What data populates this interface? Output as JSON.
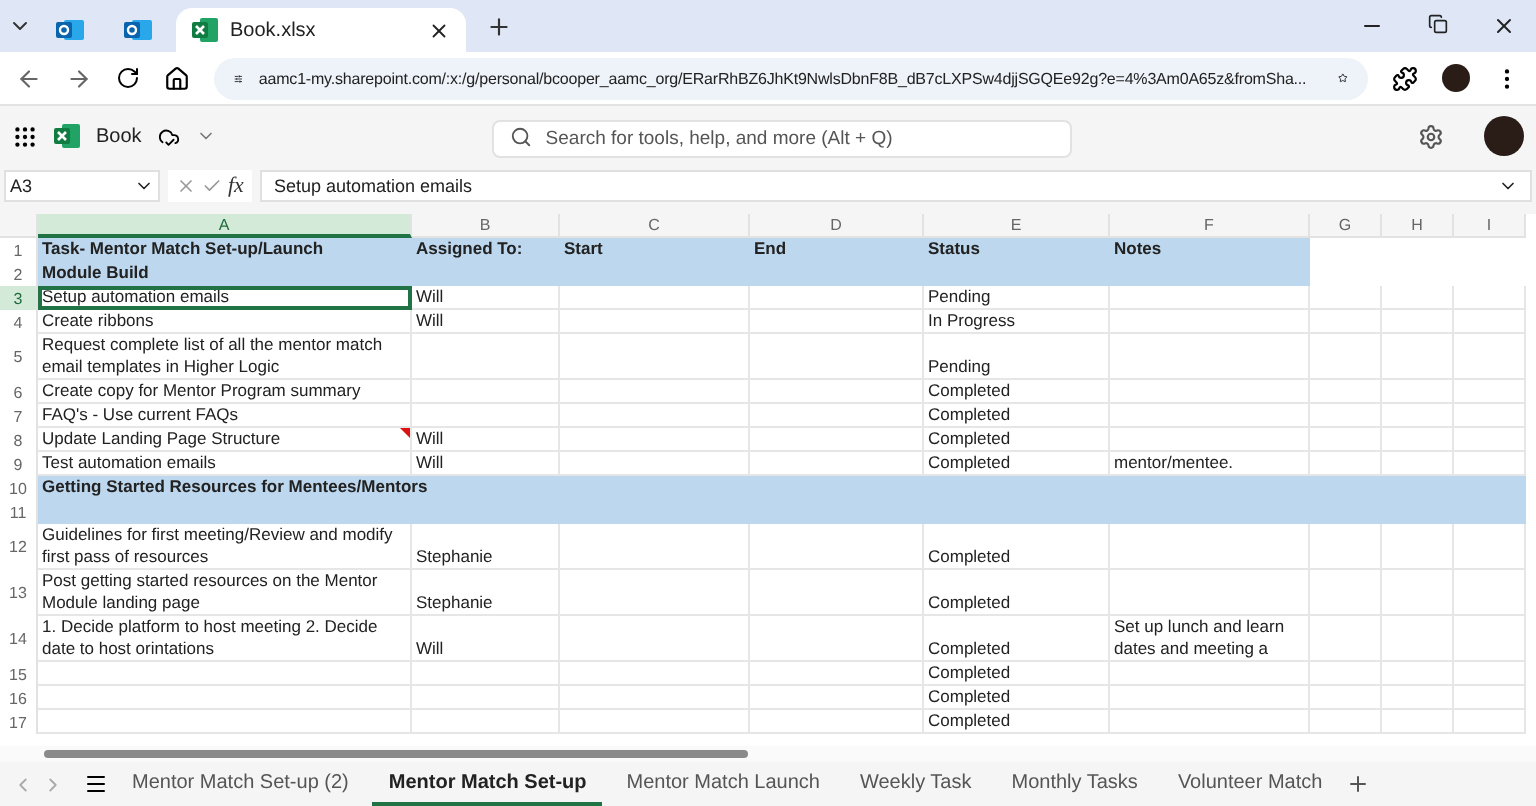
{
  "browser": {
    "tabs": [
      {
        "kind": "icon",
        "selected": false
      },
      {
        "kind": "icon",
        "selected": false
      },
      {
        "kind": "document",
        "title": "Book.xlsx",
        "selected": true
      }
    ],
    "url": "aamc1-my.sharepoint.com/:x:/g/personal/bcooper_aamc_org/ERarRhBZ6JhKt9NwlsDbnF8B_dB7cLXPSw4djjSGQEe92g?e=4%3Am0A65z&fromSha..."
  },
  "app": {
    "document": "Book",
    "search": {
      "placeholder": "Search for tools, help, and more (Alt + Q)"
    }
  },
  "formula_bar": {
    "name_box": "A3",
    "function_label": "fx",
    "formula": "Setup automation emails"
  },
  "columns": [
    {
      "label": "A",
      "selected": true
    },
    {
      "label": "B",
      "selected": false
    },
    {
      "label": "C",
      "selected": false
    },
    {
      "label": "D",
      "selected": false
    },
    {
      "label": "E",
      "selected": false
    },
    {
      "label": "F",
      "selected": false
    },
    {
      "label": "G",
      "selected": false
    },
    {
      "label": "H",
      "selected": false
    },
    {
      "label": "I",
      "selected": false
    }
  ],
  "rows": [
    {
      "number": "1",
      "kind": "title",
      "selected": false,
      "comment": false,
      "cells": {
        "task": "Task- Mentor Match Set-up/Launch",
        "assigned": "Assigned To:",
        "start": "Start",
        "end": "End",
        "status": "Status",
        "notes": "Notes"
      }
    },
    {
      "number": "2",
      "kind": "title",
      "selected": false,
      "comment": false,
      "cells": {
        "task": "Module Build"
      }
    },
    {
      "number": "3",
      "kind": "task",
      "selected": true,
      "comment": false,
      "cells": {
        "task": "Setup automation emails",
        "assigned": "Will",
        "status": "Pending"
      }
    },
    {
      "number": "4",
      "kind": "task",
      "selected": false,
      "comment": false,
      "cells": {
        "task": "Create ribbons",
        "assigned": "Will",
        "status": "In Progress"
      }
    },
    {
      "number": "5",
      "kind": "task",
      "selected": false,
      "comment": false,
      "cells": {
        "task": "Request complete list of all the mentor match email templates in Higher Logic",
        "status": "Pending"
      }
    },
    {
      "number": "6",
      "kind": "task",
      "selected": false,
      "comment": false,
      "cells": {
        "task": "Create copy for Mentor Program summary",
        "status": "Completed"
      }
    },
    {
      "number": "7",
      "kind": "task",
      "selected": false,
      "comment": false,
      "cells": {
        "task": "FAQ's - Use current FAQs",
        "status": "Completed"
      }
    },
    {
      "number": "8",
      "kind": "task",
      "selected": false,
      "comment": true,
      "cells": {
        "task": "Update Landing Page Structure",
        "assigned": "Will",
        "status": "Completed"
      }
    },
    {
      "number": "9",
      "kind": "task",
      "selected": false,
      "comment": false,
      "cells": {
        "task": "Test automation emails",
        "assigned": "Will",
        "status": "Completed",
        "notes": "mentor/mentee."
      }
    },
    {
      "number": "10",
      "kind": "section",
      "selected": false,
      "comment": false,
      "cells": {
        "task": "Getting Started Resources for Mentees/Mentors"
      }
    },
    {
      "number": "11",
      "kind": "section",
      "selected": false,
      "comment": false
    },
    {
      "number": "12",
      "kind": "task",
      "selected": false,
      "comment": false,
      "cells": {
        "task": "Guidelines for first meeting/Review and modify first pass of resources",
        "assigned": "Stephanie",
        "status": "Completed"
      }
    },
    {
      "number": "13",
      "kind": "task",
      "selected": false,
      "comment": false,
      "cells": {
        "task": "Post getting started resources on the Mentor Module landing page",
        "assigned": "Stephanie",
        "status": "Completed"
      }
    },
    {
      "number": "14",
      "kind": "task",
      "selected": false,
      "comment": false,
      "cells": {
        "task": "1. Decide platform to host meeting 2. Decide date to host orintations",
        "assigned": "Will",
        "status": "Completed",
        "notes": "Set up lunch and learn dates and meeting a"
      }
    },
    {
      "number": "15",
      "kind": "task",
      "selected": false,
      "comment": false,
      "cells": {
        "status": "Completed"
      }
    },
    {
      "number": "16",
      "kind": "task",
      "selected": false,
      "comment": false,
      "cells": {
        "status": "Completed"
      }
    },
    {
      "number": "17",
      "kind": "task",
      "selected": false,
      "comment": false,
      "cells": {
        "status": "Completed"
      }
    }
  ],
  "sheet_tabs": [
    {
      "label": "Mentor Match Set-up (2)",
      "selected": false
    },
    {
      "label": "Mentor Match Set-up",
      "selected": true
    },
    {
      "label": "Mentor Match Launch",
      "selected": false
    },
    {
      "label": "Weekly Task",
      "selected": false
    },
    {
      "label": "Monthly Tasks",
      "selected": false
    },
    {
      "label": "Volunteer Match",
      "selected": false
    }
  ]
}
